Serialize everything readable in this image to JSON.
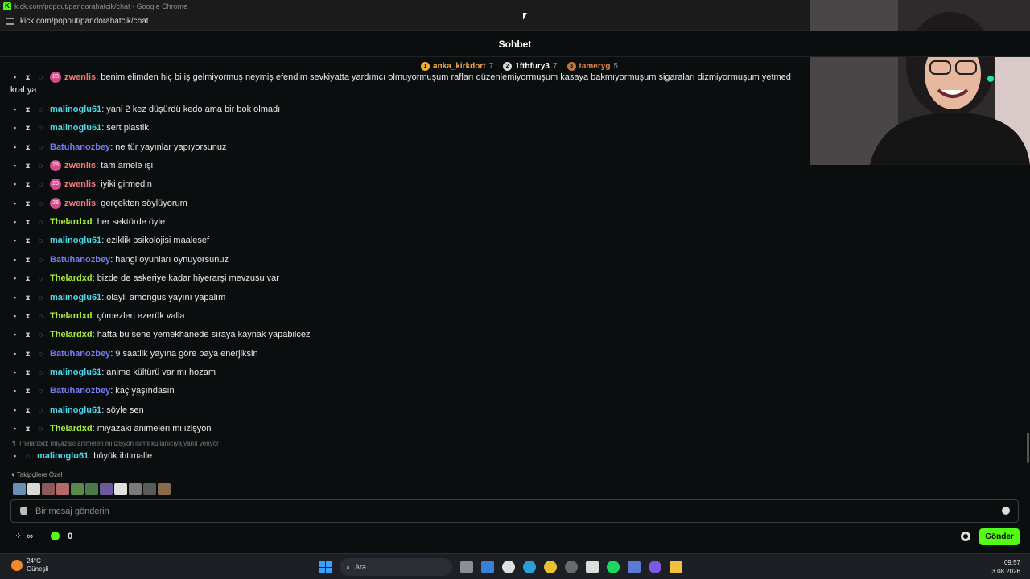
{
  "browser": {
    "window_title": "kick.com/popout/pandorahatcik/chat - Google Chrome",
    "url": "kick.com/popout/pandorahatcik/chat",
    "favicon_letter": "K"
  },
  "chat": {
    "title": "Sohbet",
    "pinned_gifters": [
      {
        "rank": "1",
        "name": "anka_kirkdort",
        "count": "7",
        "color": "#f0a848"
      },
      {
        "rank": "2",
        "name": "1fthfury3",
        "count": "7",
        "color": "#ffffff"
      },
      {
        "rank": "3",
        "name": "tameryg",
        "count": "5",
        "color": "#e0874a"
      }
    ],
    "truncated_message": {
      "user": "zwenlis",
      "text": ": benim elimden hiç bi iş gelmiyormuş neymiş efendim sevkiyatta yardımcı olmuyormuşum rafları düzenlemiyormuşum kasaya bakmıyormuşum sigaraları dizmiyormuşum yetmed",
      "wrap": "kral ya"
    },
    "messages": [
      {
        "user": "malinoglu61",
        "text": ": yani 2 kez düşürdü kedo ama bir bok olmadı",
        "color": "#4fd9e8",
        "sub": false
      },
      {
        "user": "malinoglu61",
        "text": ": sert plastik",
        "color": "#4fd9e8",
        "sub": false
      },
      {
        "user": "Batuhanozbey",
        "text": ": ne tür yayınlar yapıyorsunuz",
        "color": "#7a7af0",
        "sub": false
      },
      {
        "user": "zwenlis",
        "text": ": tam amele işi",
        "color": "#f07a7a",
        "sub": true
      },
      {
        "user": "zwenlis",
        "text": ": iyiki girmedin",
        "color": "#f07a7a",
        "sub": true
      },
      {
        "user": "zwenlis",
        "text": ": gerçekten söylüyorum",
        "color": "#f07a7a",
        "sub": true
      },
      {
        "user": "Thelardxd",
        "text": ": her sektörde öyle",
        "color": "#a8f03c",
        "sub": false
      },
      {
        "user": "malinoglu61",
        "text": ": eziklik psikolojisi maalesef",
        "color": "#4fd9e8",
        "sub": false
      },
      {
        "user": "Batuhanozbey",
        "text": ": hangi oyunları oynuyorsunuz",
        "color": "#7a7af0",
        "sub": false
      },
      {
        "user": "Thelardxd",
        "text": ": bizde de askeriye kadar hiyerarşi mevzusu var",
        "color": "#a8f03c",
        "sub": false
      },
      {
        "user": "malinoglu61",
        "text": ": olaylı amongus yayını yapalım",
        "color": "#4fd9e8",
        "sub": false
      },
      {
        "user": "Thelardxd",
        "text": ": çömezleri ezerük valla",
        "color": "#a8f03c",
        "sub": false
      },
      {
        "user": "Thelardxd",
        "text": ": hatta bu sene yemekhanede sıraya kaynak yapabilcez",
        "color": "#a8f03c",
        "sub": false
      },
      {
        "user": "Batuhanozbey",
        "text": ": 9 saatlik yayına göre baya enerjiksin",
        "color": "#7a7af0",
        "sub": false
      },
      {
        "user": "malinoglu61",
        "text": ": anime kültürü var mı hozam",
        "color": "#4fd9e8",
        "sub": false
      },
      {
        "user": "Batuhanozbey",
        "text": ": kaç yaşındasın",
        "color": "#7a7af0",
        "sub": false
      },
      {
        "user": "malinoglu61",
        "text": ": söyle sen",
        "color": "#4fd9e8",
        "sub": false
      },
      {
        "user": "Thelardxd",
        "text": ": miyazaki animeleri mi izlşyon",
        "color": "#a8f03c",
        "sub": false
      }
    ],
    "reply_note": "Thelardxd: miyazaki animeleri mi izlşyon isimli kullanıcıya yanıt veriyor",
    "reply_message": {
      "user": "malinoglu61",
      "text": ": büyük ihtimalle",
      "color": "#4fd9e8"
    },
    "sub_badge_text": "28",
    "followers_label": "♥ Takipçilere Özel",
    "emotes": [
      "#6a8fb5",
      "#d9d9d9",
      "#8a5a5a",
      "#b56a6a",
      "#5a8a4a",
      "#4a7a4a",
      "#6a5a9a",
      "#e0e0e0",
      "#7a7a7a",
      "#5a5a5a",
      "#8a6a4a"
    ],
    "input_placeholder": "Bir mesaj gönderin",
    "infinity_label": "∞",
    "points_value": "0",
    "send_label": "Gönder",
    "accent": "#53fc18"
  },
  "taskbar": {
    "temperature": "24°C",
    "weather": "Güneşli",
    "search_label": "Ara",
    "time": "09:57",
    "date": "3.08.2026"
  }
}
